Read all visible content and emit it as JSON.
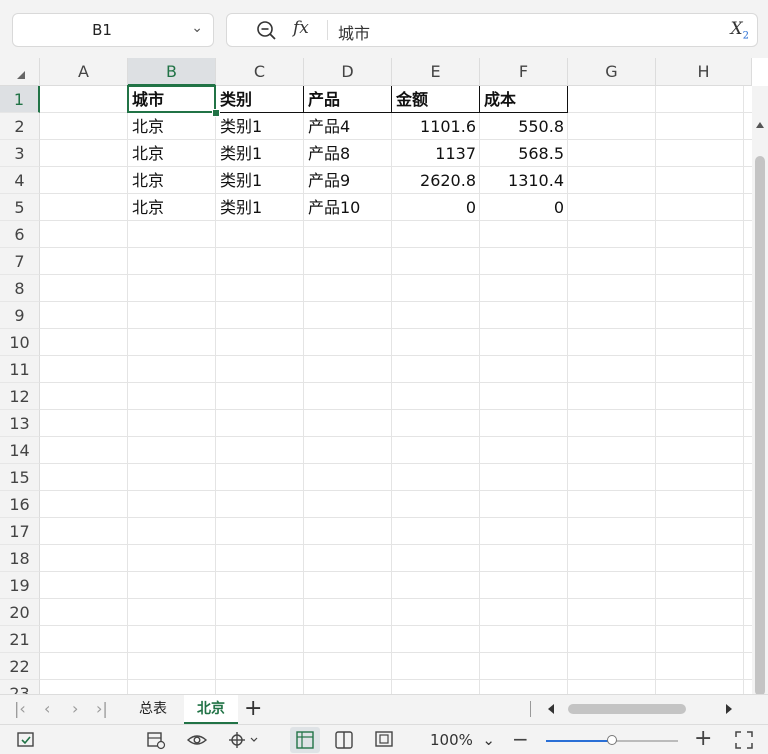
{
  "formula_bar": {
    "name_box": "B1",
    "formula_value": "城市",
    "fx_label": "fx",
    "clear_label": "X"
  },
  "columns": [
    "A",
    "B",
    "C",
    "D",
    "E",
    "F",
    "G",
    "H"
  ],
  "selected_column": "B",
  "rows": [
    "1",
    "2",
    "3",
    "4",
    "5",
    "6",
    "7",
    "8",
    "9",
    "10",
    "11",
    "12",
    "13",
    "14",
    "15",
    "16",
    "17",
    "18",
    "19",
    "20",
    "21",
    "22",
    "23"
  ],
  "selected_row": "1",
  "table": {
    "headers": [
      "城市",
      "类别",
      "产品",
      "金额",
      "成本"
    ],
    "rows": [
      [
        "北京",
        "类别1",
        "产品4",
        "1101.6",
        "550.8"
      ],
      [
        "北京",
        "类别1",
        "产品8",
        "1137",
        "568.5"
      ],
      [
        "北京",
        "类别1",
        "产品9",
        "2620.8",
        "1310.4"
      ],
      [
        "北京",
        "类别1",
        "产品10",
        "0",
        "0"
      ]
    ]
  },
  "sheet_tabs": [
    {
      "label": "总表",
      "active": false
    },
    {
      "label": "北京",
      "active": true
    }
  ],
  "status": {
    "zoom": "100%",
    "zoom_level_fraction": 0.5
  },
  "colors": {
    "accent": "#217346",
    "zoom_accent": "#2a6fd6"
  },
  "icons": {
    "zoom": "zoom-out-icon",
    "clear": "clear-format-icon",
    "nav_first": "first-sheet-icon",
    "nav_prev": "prev-sheet-icon",
    "nav_next": "next-sheet-icon",
    "nav_last": "last-sheet-icon",
    "add": "add-sheet-icon",
    "spellcheck": "spellcheck-icon",
    "settings": "sheet-settings-icon",
    "eye": "eye-icon",
    "freeze": "freeze-icon",
    "normal_view": "normal-view-icon",
    "page_break": "page-break-view-icon",
    "page_layout": "page-layout-icon",
    "zoom_minus": "zoom-minus-icon",
    "zoom_plus": "zoom-plus-icon",
    "fullscreen": "fullscreen-icon"
  }
}
